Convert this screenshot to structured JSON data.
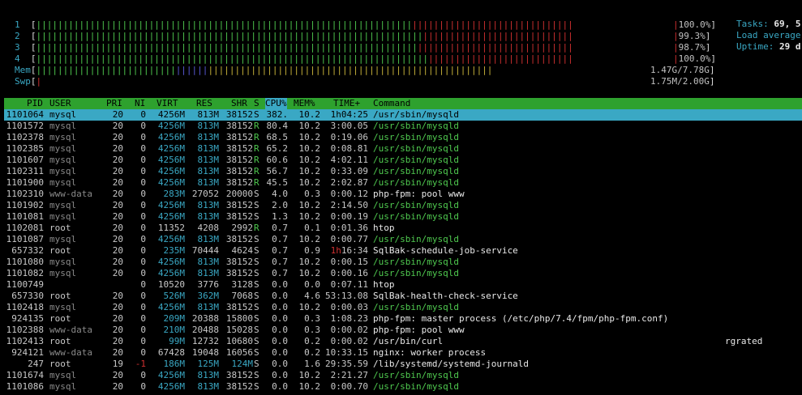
{
  "meters": {
    "cpus": [
      {
        "label": "1",
        "value": "100.0%",
        "green": 70,
        "red": 30
      },
      {
        "label": "2",
        "value": "99.3%",
        "green": 72,
        "red": 28
      },
      {
        "label": "3",
        "value": "98.7%",
        "green": 71,
        "red": 29
      },
      {
        "label": "4",
        "value": "100.0%",
        "green": 73,
        "red": 27
      }
    ],
    "mem": {
      "label": "Mem",
      "value": "1.47G/7.78G"
    },
    "swp": {
      "label": "Swp",
      "value": "1.75M/2.00G"
    }
  },
  "side": {
    "tasks_label": "Tasks: ",
    "tasks_value": "69, 5",
    "load_label": "Load average",
    "uptime_label": "Uptime: ",
    "uptime_value": "29 d"
  },
  "header": {
    "pid": "PID",
    "user": "USER",
    "pri": "PRI",
    "ni": "NI",
    "virt": "VIRT",
    "res": "RES",
    "shr": "SHR",
    "s": "S",
    "cpu": "CPU%",
    "mem": "MEM%",
    "time": "TIME+",
    "command": "Command"
  },
  "processes": [
    {
      "pid": "1101064",
      "user": "mysql",
      "pri": "20",
      "ni": "0",
      "virt": "4256M",
      "res": "813M",
      "shr": "38152",
      "s": "S",
      "cpu": "382.",
      "mem": "10.2",
      "time": "1h04:25",
      "cmd": "/usr/sbin/mysqld",
      "selected": true
    },
    {
      "pid": "1101572",
      "user": "mysql",
      "pri": "20",
      "ni": "0",
      "virt": "4256M",
      "res": "813M",
      "shr": "38152",
      "s": "R",
      "cpu": "80.4",
      "mem": "10.2",
      "time": "3:00.05",
      "cmd": "/usr/sbin/mysqld"
    },
    {
      "pid": "1102378",
      "user": "mysql",
      "pri": "20",
      "ni": "0",
      "virt": "4256M",
      "res": "813M",
      "shr": "38152",
      "s": "R",
      "cpu": "68.5",
      "mem": "10.2",
      "time": "0:19.06",
      "cmd": "/usr/sbin/mysqld"
    },
    {
      "pid": "1102385",
      "user": "mysql",
      "pri": "20",
      "ni": "0",
      "virt": "4256M",
      "res": "813M",
      "shr": "38152",
      "s": "R",
      "cpu": "65.2",
      "mem": "10.2",
      "time": "0:08.81",
      "cmd": "/usr/sbin/mysqld"
    },
    {
      "pid": "1101607",
      "user": "mysql",
      "pri": "20",
      "ni": "0",
      "virt": "4256M",
      "res": "813M",
      "shr": "38152",
      "s": "R",
      "cpu": "60.6",
      "mem": "10.2",
      "time": "4:02.11",
      "cmd": "/usr/sbin/mysqld"
    },
    {
      "pid": "1102311",
      "user": "mysql",
      "pri": "20",
      "ni": "0",
      "virt": "4256M",
      "res": "813M",
      "shr": "38152",
      "s": "R",
      "cpu": "56.7",
      "mem": "10.2",
      "time": "0:33.09",
      "cmd": "/usr/sbin/mysqld"
    },
    {
      "pid": "1101900",
      "user": "mysql",
      "pri": "20",
      "ni": "0",
      "virt": "4256M",
      "res": "813M",
      "shr": "38152",
      "s": "R",
      "cpu": "45.5",
      "mem": "10.2",
      "time": "2:02.87",
      "cmd": "/usr/sbin/mysqld"
    },
    {
      "pid": "1102310",
      "user": "www-data",
      "pri": "20",
      "ni": "0",
      "virt": "283M",
      "res": "27052",
      "shr": "20000",
      "s": "S",
      "cpu": "4.0",
      "mem": "0.3",
      "time": "0:00.12",
      "cmd": "php-fpm: pool www"
    },
    {
      "pid": "1101902",
      "user": "mysql",
      "pri": "20",
      "ni": "0",
      "virt": "4256M",
      "res": "813M",
      "shr": "38152",
      "s": "S",
      "cpu": "2.0",
      "mem": "10.2",
      "time": "2:14.50",
      "cmd": "/usr/sbin/mysqld"
    },
    {
      "pid": "1101081",
      "user": "mysql",
      "pri": "20",
      "ni": "0",
      "virt": "4256M",
      "res": "813M",
      "shr": "38152",
      "s": "S",
      "cpu": "1.3",
      "mem": "10.2",
      "time": "0:00.19",
      "cmd": "/usr/sbin/mysqld"
    },
    {
      "pid": "1102081",
      "user": "root",
      "pri": "20",
      "ni": "0",
      "virt": "11352",
      "res": "4208",
      "shr": "2992",
      "s": "R",
      "cpu": "0.7",
      "mem": "0.1",
      "time": "0:01.36",
      "cmd": "htop"
    },
    {
      "pid": "1101087",
      "user": "mysql",
      "pri": "20",
      "ni": "0",
      "virt": "4256M",
      "res": "813M",
      "shr": "38152",
      "s": "S",
      "cpu": "0.7",
      "mem": "10.2",
      "time": "0:00.77",
      "cmd": "/usr/sbin/mysqld"
    },
    {
      "pid": "657332",
      "user": "root",
      "pri": "20",
      "ni": "0",
      "virt": "235M",
      "res": "70444",
      "shr": "4624",
      "s": "S",
      "cpu": "0.7",
      "mem": "0.9",
      "time": "1h16:34",
      "cmd": "SqlBak-schedule-job-service"
    },
    {
      "pid": "1101080",
      "user": "mysql",
      "pri": "20",
      "ni": "0",
      "virt": "4256M",
      "res": "813M",
      "shr": "38152",
      "s": "S",
      "cpu": "0.7",
      "mem": "10.2",
      "time": "0:00.15",
      "cmd": "/usr/sbin/mysqld"
    },
    {
      "pid": "1101082",
      "user": "mysql",
      "pri": "20",
      "ni": "0",
      "virt": "4256M",
      "res": "813M",
      "shr": "38152",
      "s": "S",
      "cpu": "0.7",
      "mem": "10.2",
      "time": "0:00.16",
      "cmd": "/usr/sbin/mysqld"
    },
    {
      "pid": "1100749",
      "user": "",
      "pri": "",
      "ni": "0",
      "virt": "10520",
      "res": "3776",
      "shr": "3128",
      "s": "S",
      "cpu": "0.0",
      "mem": "0.0",
      "time": "0:07.11",
      "cmd": "htop"
    },
    {
      "pid": "657330",
      "user": "root",
      "pri": "20",
      "ni": "0",
      "virt": "526M",
      "res": "362M",
      "shr": "7068",
      "s": "S",
      "cpu": "0.0",
      "mem": "4.6",
      "time": "53:13.08",
      "cmd": "SqlBak-health-check-service"
    },
    {
      "pid": "1102418",
      "user": "mysql",
      "pri": "20",
      "ni": "0",
      "virt": "4256M",
      "res": "813M",
      "shr": "38152",
      "s": "S",
      "cpu": "0.0",
      "mem": "10.2",
      "time": "0:00.03",
      "cmd": "/usr/sbin/mysqld"
    },
    {
      "pid": "924135",
      "user": "root",
      "pri": "20",
      "ni": "0",
      "virt": "209M",
      "res": "20388",
      "shr": "15800",
      "s": "S",
      "cpu": "0.0",
      "mem": "0.3",
      "time": "1:08.23",
      "cmd": "php-fpm: master process (/etc/php/7.4/fpm/php-fpm.conf)"
    },
    {
      "pid": "1102388",
      "user": "www-data",
      "pri": "20",
      "ni": "0",
      "virt": "210M",
      "res": "20488",
      "shr": "15028",
      "s": "S",
      "cpu": "0.0",
      "mem": "0.3",
      "time": "0:00.02",
      "cmd": "php-fpm: pool www"
    },
    {
      "pid": "1102413",
      "user": "root",
      "pri": "20",
      "ni": "0",
      "virt": "99M",
      "res": "12732",
      "shr": "10680",
      "s": "S",
      "cpu": "0.0",
      "mem": "0.2",
      "time": "0:00.02",
      "cmd": "/usr/bin/curl",
      "extra": "rgrated"
    },
    {
      "pid": "924121",
      "user": "www-data",
      "pri": "20",
      "ni": "0",
      "virt": "67428",
      "res": "19048",
      "shr": "16056",
      "s": "S",
      "cpu": "0.0",
      "mem": "0.2",
      "time": "10:33.15",
      "cmd": "nginx: worker process"
    },
    {
      "pid": "247",
      "user": "root",
      "pri": "19",
      "ni": "-1",
      "virt": "186M",
      "res": "125M",
      "shr": "124M",
      "s": "S",
      "cpu": "0.0",
      "mem": "1.6",
      "time": "29:35.59",
      "cmd": "/lib/systemd/systemd-journald"
    },
    {
      "pid": "1101674",
      "user": "mysql",
      "pri": "20",
      "ni": "0",
      "virt": "4256M",
      "res": "813M",
      "shr": "38152",
      "s": "S",
      "cpu": "0.0",
      "mem": "10.2",
      "time": "2:21.27",
      "cmd": "/usr/sbin/mysqld"
    },
    {
      "pid": "1101086",
      "user": "mysql",
      "pri": "20",
      "ni": "0",
      "virt": "4256M",
      "res": "813M",
      "shr": "38152",
      "s": "S",
      "cpu": "0.0",
      "mem": "10.2",
      "time": "0:00.70",
      "cmd": "/usr/sbin/mysqld"
    }
  ]
}
